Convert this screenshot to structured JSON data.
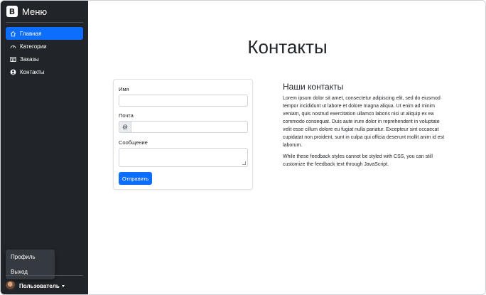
{
  "sidebar": {
    "brand_logo": "B",
    "brand_title": "Меню",
    "items": [
      {
        "label": "Главная",
        "icon": "home-icon",
        "active": true
      },
      {
        "label": "Категории",
        "icon": "speedometer-icon",
        "active": false
      },
      {
        "label": "Заказы",
        "icon": "table-icon",
        "active": false
      },
      {
        "label": "Контакты",
        "icon": "person-circle-icon",
        "active": false
      }
    ],
    "dropdown": [
      "Профиль",
      "Выход"
    ],
    "user_name": "Пользователь"
  },
  "main": {
    "title": "Контакты",
    "form": {
      "name_label": "Имя",
      "email_label": "Почта",
      "email_addon": "@",
      "message_label": "Сообщение",
      "submit_label": "Отправить"
    },
    "contacts": {
      "heading": "Наши контакты",
      "paragraph1": "Lorem ipsum dolor sit amet, consectetur adipiscing elit, sed do eiusmod tempor incididunt ut labore et dolore magna aliqua. Ut enim ad minim veniam, quis nostrud exercitation ullamco laboris nisi ut aliquip ex ea commodo consequat. Duis aute irure dolor in reprehenderit in voluptate velit esse cillum dolore eu fugiat nulla pariatur. Excepteur sint occaecat cupidatat non proident, sunt in culpa qui officia deserunt mollit anim id est laborum.",
      "paragraph2": "While these feedback styles cannot be styled with CSS, you can still customize the feedback text through JavaScript."
    }
  },
  "colors": {
    "sidebar_bg": "#212529",
    "accent": "#0d6efd",
    "dropdown_bg": "#343a40"
  }
}
